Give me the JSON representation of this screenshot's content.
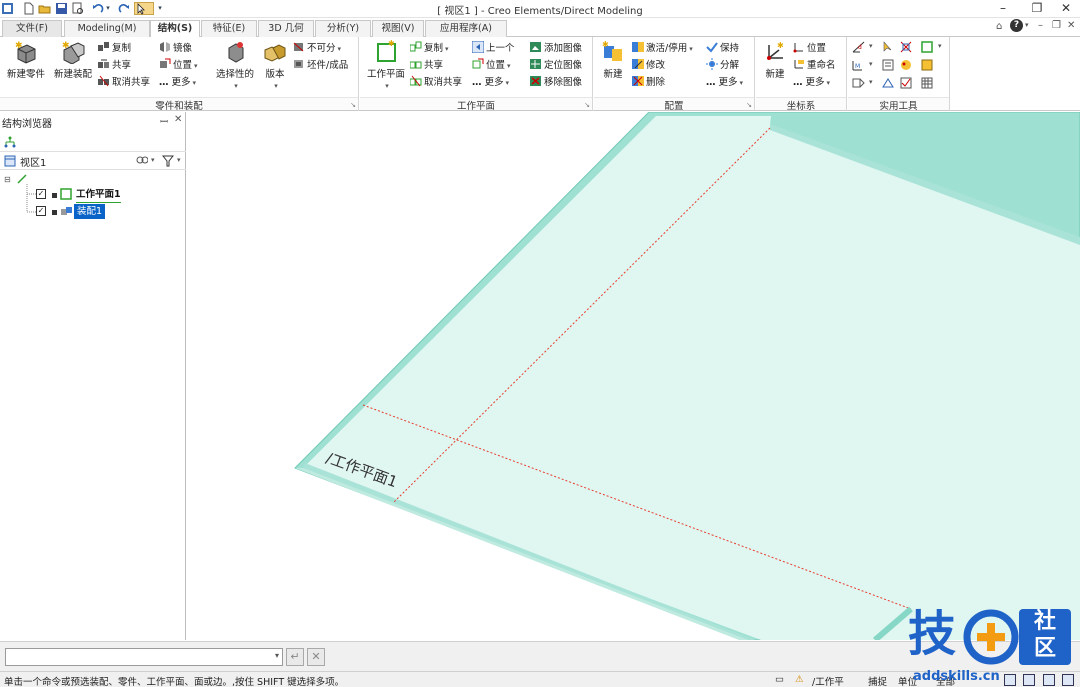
{
  "window": {
    "title": "[ 视区1 ] - Creo Elements/Direct Modeling",
    "help_mark": "?"
  },
  "tabs": [
    {
      "label": "文件(F)"
    },
    {
      "label": "Modeling(M)"
    },
    {
      "label": "结构(S)"
    },
    {
      "label": "特征(E)"
    },
    {
      "label": "3D 几何"
    },
    {
      "label": "分析(Y)"
    },
    {
      "label": "视图(V)"
    },
    {
      "label": "应用程序(A)"
    }
  ],
  "ribbon": {
    "parts": {
      "label": "零件和装配",
      "new_part": "新建零件",
      "new_assembly": "新建装配",
      "copy": "复制",
      "share": "共享",
      "unshare": "取消共享",
      "mirror": "镜像",
      "position": "位置",
      "more": "更多",
      "selective": "选择性的",
      "version": "版本",
      "indivisible": "不可分",
      "stock": "坯件/成品"
    },
    "workplane": {
      "label": "工作平面",
      "workplane": "工作平面",
      "copy": "复制",
      "share": "共享",
      "unshare": "取消共享",
      "prev": "上一个",
      "position": "位置",
      "more": "更多",
      "add_image": "添加图像",
      "locate_image": "定位图像",
      "remove_image": "移除图像"
    },
    "config": {
      "label": "配置",
      "new": "新建",
      "activate": "激活/停用",
      "modify": "修改",
      "delete": "删除",
      "keep": "保持",
      "explode": "分解",
      "more": "更多"
    },
    "coord": {
      "label": "坐标系",
      "new": "新建",
      "position": "位置",
      "rename": "重命名",
      "more": "更多"
    },
    "utils": {
      "label": "实用工具"
    }
  },
  "browser": {
    "title": "结构浏览器",
    "view_name": "视区1",
    "items": [
      {
        "label": "工作平面1",
        "checked": true
      },
      {
        "label": "装配1",
        "checked": true
      }
    ]
  },
  "viewport": {
    "workplane_label": "/工作平面1"
  },
  "cmdline": {
    "value": ""
  },
  "status": {
    "message": "单击一个命令或预选装配、零件、工作平面、面或边。,按住 SHIFT 键选择多项。",
    "workplane": "/工作平",
    "snap": "捕捉",
    "units": "单位",
    "all": "全部"
  },
  "watermark": {
    "site": "addskills.cn",
    "main_char": "技",
    "sub1": "社",
    "sub2": "区"
  },
  "colors": {
    "accent_blue": "#0a64c8",
    "workplane_fill": "#dff6f1",
    "workplane_border": "#86d7c6",
    "axis_red": "#e83d2e",
    "watermark_blue": "#1f62c8",
    "watermark_orange": "#f39c12"
  }
}
